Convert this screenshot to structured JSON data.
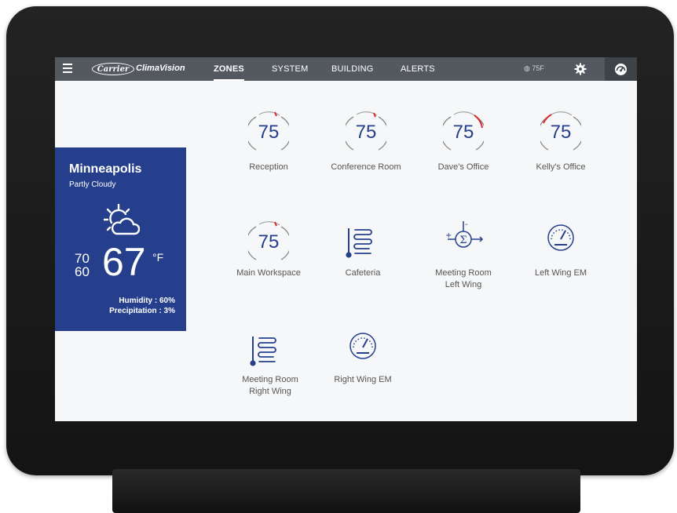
{
  "app": {
    "logo_text": "Carrier",
    "brand": "ClimaVision"
  },
  "nav": {
    "tabs": [
      {
        "label": "ZONES",
        "active": true
      },
      {
        "label": "SYSTEM",
        "active": false
      },
      {
        "label": "BUILDING",
        "active": false
      },
      {
        "label": "ALERTS",
        "active": false
      }
    ],
    "outdoor_temp": "75F"
  },
  "weather": {
    "city": "Minneapolis",
    "condition": "Partly Cloudy",
    "high": "70",
    "low": "60",
    "current": "67",
    "unit": "°F",
    "humidity": "Humidity : 60%",
    "precipitation": "Precipitation : 3%"
  },
  "zones": [
    {
      "label": "Reception",
      "setpoint": "75",
      "kind": "thermostat"
    },
    {
      "label": "Conference Room",
      "setpoint": "75",
      "kind": "thermostat"
    },
    {
      "label": "Dave's Office",
      "setpoint": "75",
      "kind": "thermostat"
    },
    {
      "label": "Kelly's Office",
      "setpoint": "75",
      "kind": "thermostat"
    },
    {
      "label": "Main Workspace",
      "setpoint": "75",
      "kind": "thermostat"
    },
    {
      "label": "Cafeteria",
      "kind": "radiant-icon"
    },
    {
      "label": "Meeting Room",
      "label2": "Left Wing",
      "kind": "sigma-icon"
    },
    {
      "label": "Left Wing EM",
      "kind": "meter-icon"
    },
    {
      "label": "Meeting Room",
      "label2": "Right Wing",
      "kind": "radiant-icon"
    },
    {
      "label": "Right Wing EM",
      "kind": "meter-icon"
    }
  ],
  "colors": {
    "accent": "#253f8c",
    "nav_bg": "#54595f",
    "setpoint_marker": "#d9292b"
  }
}
